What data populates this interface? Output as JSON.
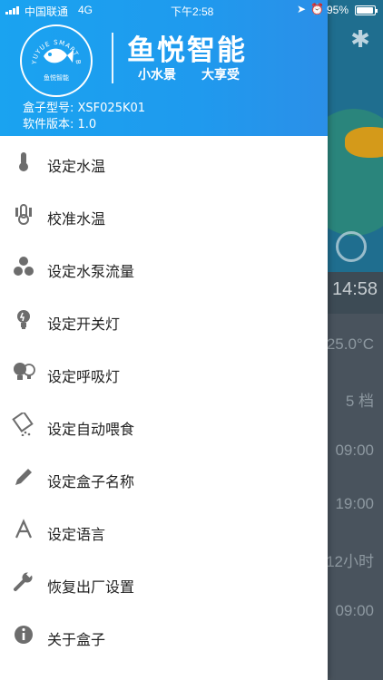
{
  "status_bar": {
    "carrier": "中国联通",
    "network": "4G",
    "time": "下午2:58",
    "battery": "95%",
    "location_icon": "location-arrow-icon",
    "alarm_icon": "alarm-icon"
  },
  "header": {
    "brand": "鱼悦智能",
    "slogan_left": "小水景",
    "slogan_right": "大享受",
    "logo_ring_text": "YUYUE SMART BOX",
    "logo_cn": "鱼悦智能",
    "box_model": "盒子型号: XSF025K01",
    "software_version": "软件版本:  1.0"
  },
  "menu": [
    {
      "label": "设定水温",
      "icon": "thermometer-icon"
    },
    {
      "label": "校准水温",
      "icon": "thermometer-calibrate-icon"
    },
    {
      "label": "设定水泵流量",
      "icon": "fan-icon"
    },
    {
      "label": "设定开关灯",
      "icon": "bulb-icon"
    },
    {
      "label": "设定呼吸灯",
      "icon": "breathing-light-icon"
    },
    {
      "label": "设定自动喂食",
      "icon": "feeder-icon"
    },
    {
      "label": "设定盒子名称",
      "icon": "pencil-icon"
    },
    {
      "label": "设定语言",
      "icon": "language-icon"
    },
    {
      "label": "恢复出厂设置",
      "icon": "wrench-icon"
    },
    {
      "label": "关于盒子",
      "icon": "info-icon"
    }
  ],
  "background": {
    "time": "14:58",
    "values": [
      "25.0°C",
      "5 档",
      "09:00",
      "19:00",
      "12小时",
      "09:00"
    ]
  },
  "colors": {
    "header_blue": "#1aa3f0",
    "icon_gray": "#6d6d6d",
    "text": "#222222"
  }
}
